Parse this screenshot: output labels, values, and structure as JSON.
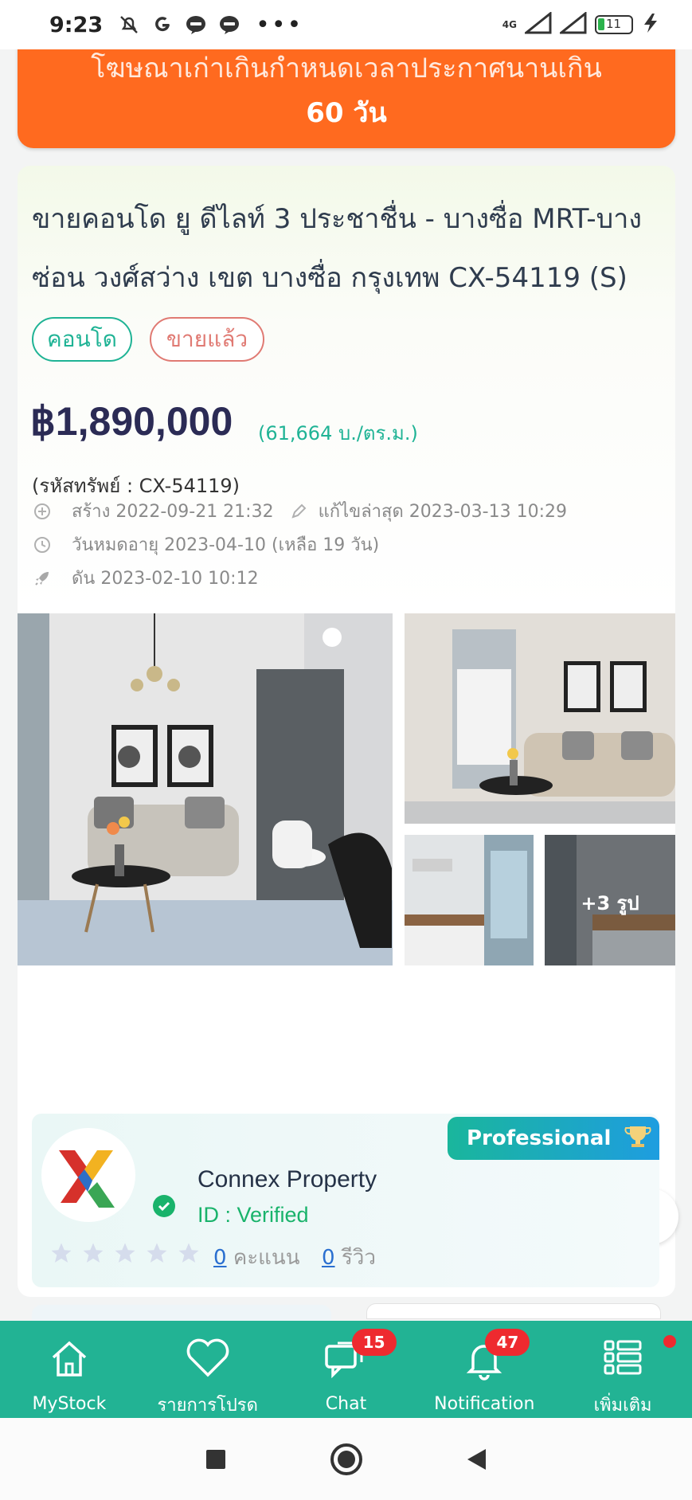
{
  "status_bar": {
    "time": "9:23",
    "network": "4G",
    "battery": "11"
  },
  "banner": {
    "line1": "โฆษณาเก่าเกินกำหนดเวลาประกาศนานเกิน",
    "line2": "60 วัน"
  },
  "listing": {
    "title": "ขายคอนโด ยู ดีไลท์ 3 ประชาชื่น - บางซื่อ MRT-บางซ่อน วงศ์สว่าง เขต บางซื่อ กรุงเทพ CX-54119 (S)",
    "chip_type": "คอนโด",
    "chip_status": "ขายแล้ว",
    "price": "฿1,890,000",
    "price_per_sqm": "(61,664 บ./ตร.ม.)",
    "code": "(รหัสทรัพย์ : CX-54119)",
    "created": "สร้าง 2022-09-21 21:32",
    "edited": "แก้ไขล่าสุด 2023-03-13 10:29",
    "expiry": "วันหมดอายุ 2023-04-10  (เหลือ 19 วัน)",
    "boosted": "ดัน 2023-02-10 10:12",
    "more_photos": "+3 รูป"
  },
  "agent": {
    "badge": "Professional",
    "name": "Connex Property",
    "id_label": "ID : Verified",
    "rating_count": "0",
    "rating_label": "คะแนน",
    "review_count": "0",
    "review_label": "รีวิว"
  },
  "bottom_nav": [
    {
      "label": "MyStock",
      "icon": "home-icon"
    },
    {
      "label": "รายการโปรด",
      "icon": "heart-icon"
    },
    {
      "label": "Chat",
      "icon": "chat-icon",
      "badge": "15"
    },
    {
      "label": "Notification",
      "icon": "bell-icon",
      "badge": "47"
    },
    {
      "label": "เพิ่มเติม",
      "icon": "list-icon"
    }
  ],
  "colors": {
    "banner": "#ff6a1f",
    "accent": "#22b394",
    "sold": "#e07a73",
    "price": "#2b2b55",
    "badge": "#ee2a2f"
  }
}
